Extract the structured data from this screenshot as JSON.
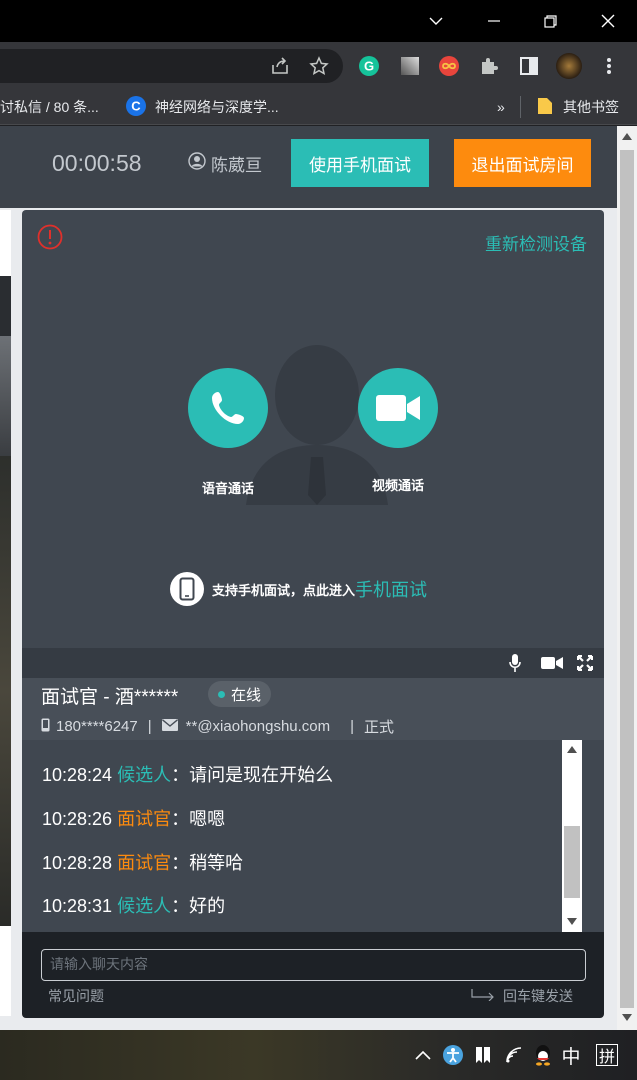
{
  "browser": {
    "bookmarks": [
      "讨私信 / 80 条...",
      "神经网络与深度学...",
      "其他书签"
    ],
    "more_label": "»"
  },
  "header": {
    "timer": "00:00:58",
    "user_name": "陈葳亘",
    "phone_button": "使用手机面试",
    "exit_button": "退出面试房间"
  },
  "video": {
    "redetect": "重新检测设备",
    "voice_call": "语音通话",
    "video_call": "视频通话",
    "mobile_text": "支持手机面试，点此进入",
    "mobile_link": "手机面试"
  },
  "interviewer": {
    "name": "面试官 - 酒******",
    "status": "在线",
    "phone": "180****6247",
    "email": "**@xiaohongshu.com",
    "separator": "|",
    "type": "正式"
  },
  "chat": {
    "messages": [
      {
        "time": "10:28:24",
        "role": "候选人",
        "text": "请问是现在开始么",
        "role_type": "candidate"
      },
      {
        "time": "10:28:26",
        "role": "面试官",
        "text": "嗯嗯",
        "role_type": "interviewer"
      },
      {
        "time": "10:28:28",
        "role": "面试官",
        "text": "稍等哈",
        "role_type": "interviewer"
      },
      {
        "time": "10:28:31",
        "role": "候选人",
        "text": "好的",
        "role_type": "candidate"
      }
    ],
    "colon": "：",
    "input_placeholder": "请输入聊天内容",
    "faq": "常见问题",
    "enter_send": "回车键发送"
  },
  "taskbar": {
    "ime_lang": "中",
    "ime_mode": "拼"
  },
  "colors": {
    "accent_teal": "#2bbdb5",
    "accent_orange": "#fd8b0e",
    "header_bg": "#3d434b",
    "video_bg": "#404750"
  }
}
